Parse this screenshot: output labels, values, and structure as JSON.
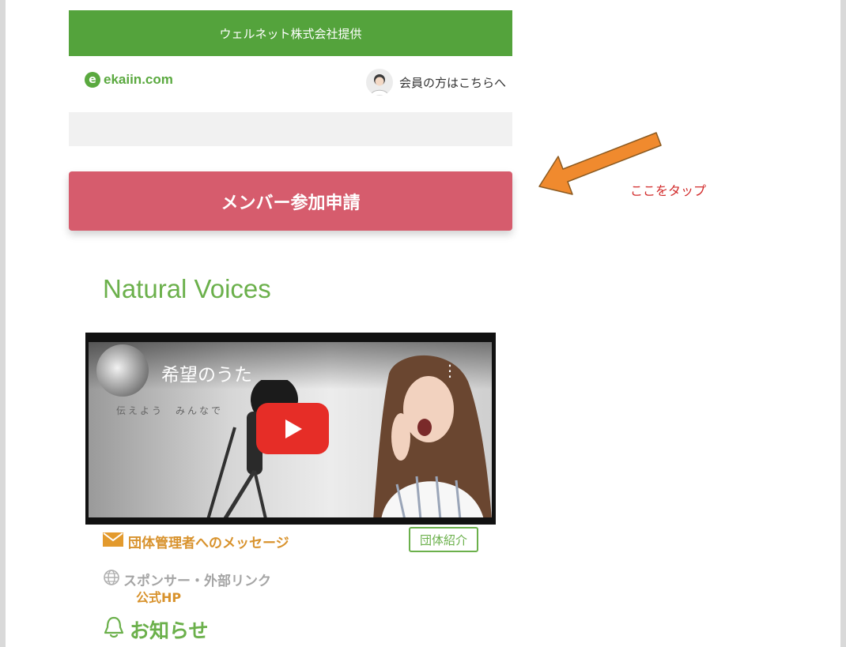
{
  "banner": {
    "text": "ウェルネット株式会社提供"
  },
  "header": {
    "logo_text": "ekaiin.com",
    "member_link": "会員の方はこちらへ"
  },
  "join_button": {
    "label": "メンバー参加申請"
  },
  "annotation": {
    "note": "ここをタップ",
    "arrow_color": "#f08a2e"
  },
  "group": {
    "title": "Natural Voices"
  },
  "video": {
    "title": "希望のうた",
    "subtitle": "伝えよう　みんなで"
  },
  "links": {
    "message_admin": "団体管理者へのメッセージ",
    "group_intro": "団体紹介",
    "sponsor_label": "スポンサー・外部リンク",
    "official_hp": "公式HP",
    "news": "お知らせ"
  },
  "colors": {
    "brand_green": "#54a33c",
    "join_pink": "#d65c6d",
    "link_orange": "#d8922c",
    "youtube_red": "#e62d27"
  }
}
